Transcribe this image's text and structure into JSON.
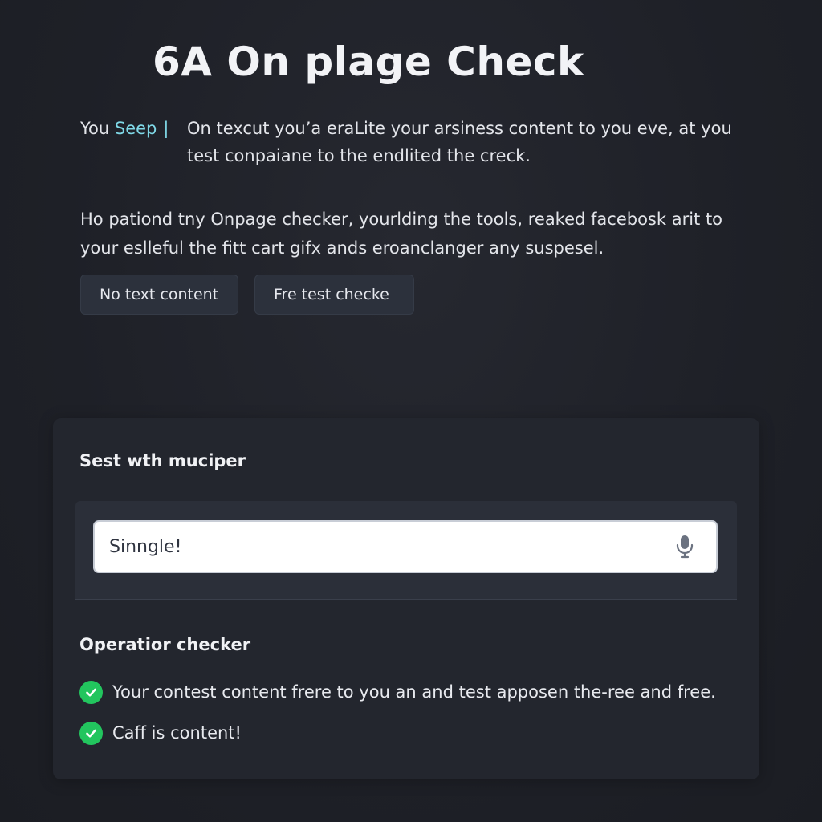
{
  "header": {
    "title": "6A On plage Check"
  },
  "intro": {
    "lead": "You",
    "accent": "Seep",
    "separator": "|",
    "body": "On texcut you’a eraLite your arsiness content to you eve, at you test conpaiane to the endlited the creck."
  },
  "description": "Ho pationd tny Onpage checker, yourlding the tools, reaked facebosk arit to your eslleful the fitt cart gifx ands eroanclanger any suspesel.",
  "chips": [
    {
      "label": "No text content"
    },
    {
      "label": "Fre test checke"
    }
  ],
  "panel": {
    "heading": "Sest wth muciper",
    "search": {
      "value": "Sinngle!",
      "mic_icon": "microphone-icon"
    },
    "operation": {
      "heading": "Operatior checker",
      "items": [
        {
          "text": "Your contest content frere to you an and test apposen the-ree and free.",
          "icon": "check-circle-icon"
        },
        {
          "text": "Caff is content!",
          "icon": "check-circle-icon"
        }
      ]
    }
  },
  "colors": {
    "background": "#1f2128",
    "accent": "#7fd8e6",
    "success": "#22c55e",
    "chip_bg": "#2c313c",
    "panel_bg": "#23262e"
  }
}
